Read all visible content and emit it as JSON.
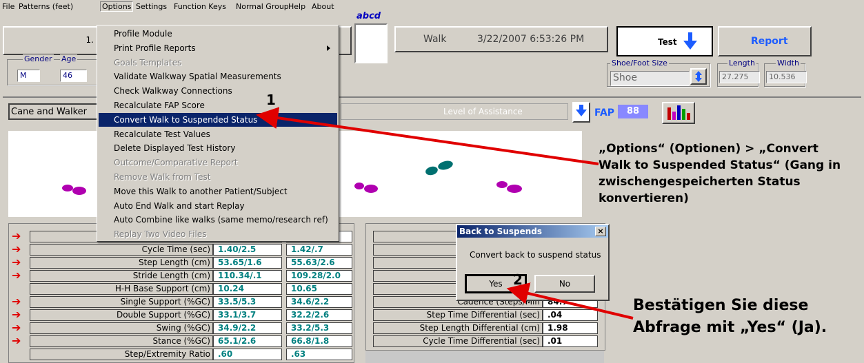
{
  "menubar": {
    "items": [
      "File",
      "Patterns (feet)",
      "Options",
      "Settings",
      "Function Keys",
      "Normal Group",
      "Help",
      "About"
    ]
  },
  "header": {
    "left_value": "1.",
    "abcd_label": "abcd",
    "walk_label": "Walk",
    "walk_datetime": "3/22/2007 6:53:26 PM",
    "test_label": "Test",
    "report_label": "Report",
    "gender_label": "Gender",
    "age_label": "Age",
    "gender_value": "M",
    "age_value": "46",
    "shoe_group_label": "Shoe/Foot Size",
    "shoe_value": "Shoe",
    "length_label": "Length",
    "width_label": "Width",
    "length_value": "27.275",
    "width_value": "10.536"
  },
  "assist_bar": {
    "cane_label": "Cane and Walker",
    "level_label": "Level of Assistance",
    "fap_label": "FAP",
    "fap_value": "88",
    "chart_icon": "bar-chart-icon"
  },
  "options_menu": {
    "items": [
      {
        "label": "Profile Module",
        "enabled": true
      },
      {
        "label": "Print Profile Reports",
        "enabled": true,
        "submenu": true
      },
      {
        "label": "Goals Templates",
        "enabled": false
      },
      {
        "label": "Validate Walkway Spatial Measurements",
        "enabled": true
      },
      {
        "label": "Check Walkway Connections",
        "enabled": true
      },
      {
        "label": "Recalculate FAP Score",
        "enabled": true
      },
      {
        "label": "Convert Walk to Suspended Status",
        "enabled": true,
        "selected": true
      },
      {
        "label": "Recalculate Test Values",
        "enabled": true
      },
      {
        "label": "Delete Displayed Test History",
        "enabled": true
      },
      {
        "label": "Outcome/Comparative Report",
        "enabled": false
      },
      {
        "label": "Remove Walk from Test",
        "enabled": false
      },
      {
        "label": "Move this Walk to another Patient/Subject",
        "enabled": true
      },
      {
        "label": "Auto End Walk and start Replay",
        "enabled": true
      },
      {
        "label": "Auto Combine like walks (same memo/research ref)",
        "enabled": true
      },
      {
        "label": "Replay Two Video Files",
        "enabled": false
      }
    ]
  },
  "left_table": {
    "rows": [
      {
        "label": "",
        "left": "",
        "right": "",
        "arrow": true
      },
      {
        "label": "Cycle Time (sec)",
        "left": "1.40/2.5",
        "right": "1.42/.7",
        "arrow": true
      },
      {
        "label": "Step Length (cm)",
        "left": "53.65/1.6",
        "right": "55.63/2.6",
        "arrow": true
      },
      {
        "label": "Stride Length (cm)",
        "left": "110.34/.1",
        "right": "109.28/2.0",
        "arrow": true
      },
      {
        "label": "H-H Base Support (cm)",
        "left": "10.24",
        "right": "10.65",
        "arrow": false
      },
      {
        "label": "Single Support (%GC)",
        "left": "33.5/5.3",
        "right": "34.6/2.2",
        "arrow": true
      },
      {
        "label": "Double Support (%GC)",
        "left": "33.1/3.7",
        "right": "32.2/2.6",
        "arrow": true
      },
      {
        "label": "Swing (%GC)",
        "left": "34.9/2.2",
        "right": "33.2/5.3",
        "arrow": true
      },
      {
        "label": "Stance (%GC)",
        "left": "65.1/2.6",
        "right": "66.8/1.8",
        "arrow": true
      },
      {
        "label": "Step/Extremity Ratio",
        "left": ".60",
        "right": ".63",
        "arrow": false
      }
    ]
  },
  "right_table": {
    "rows": [
      {
        "label": "",
        "value": ""
      },
      {
        "label": "A",
        "value": ""
      },
      {
        "label": "",
        "value": ""
      },
      {
        "label": "Mear",
        "value": ""
      },
      {
        "label": "",
        "value": ""
      },
      {
        "label": "Cadence (Steps/Min",
        "value": "84.7"
      },
      {
        "label": "Step Time Differential (sec)",
        "value": ".04"
      },
      {
        "label": "Step Length Differential (cm)",
        "value": "1.98"
      },
      {
        "label": "Cycle Time Differential (sec)",
        "value": ".01"
      }
    ]
  },
  "dialog": {
    "title": "Back to Suspends",
    "message": "Convert back to suspend status",
    "yes_label": "Yes",
    "no_label": "No",
    "close_symbol": "×"
  },
  "annotations": {
    "step1": "1",
    "step2": "2",
    "note1": "„Options“ (Optionen) > „Convert Walk to Suspended Status“ (Gang in zwischengespeicherten Status konvertieren)",
    "note2": "Bestätigen Sie diese Abfrage mit „Yes“ (Ja)."
  },
  "colors": {
    "menu_highlight": "#0a246a",
    "arrow_red": "#e00000",
    "value_teal": "#008080",
    "footprint_magenta": "#b000b0",
    "footprint_teal": "#007070"
  }
}
